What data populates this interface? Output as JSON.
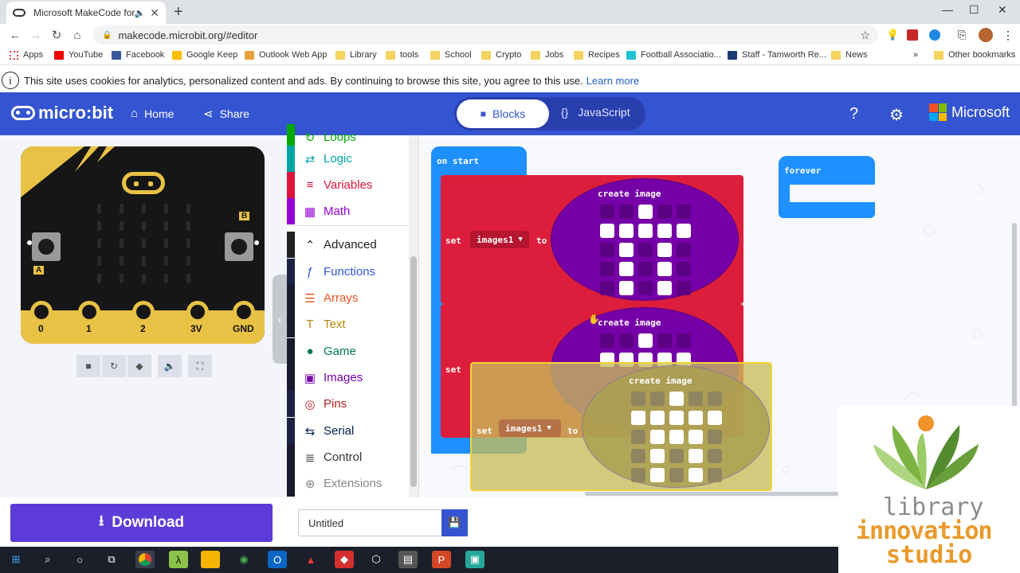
{
  "browser": {
    "tab_title": "Microsoft MakeCode for mic",
    "url": "makecode.microbit.org/#editor",
    "bookmarks": [
      "Apps",
      "YouTube",
      "Facebook",
      "Google Keep",
      "Outlook Web App",
      "Library",
      "tools",
      "School",
      "Crypto",
      "Jobs",
      "Recipes",
      "Football Associatio...",
      "Staff - Tamworth Re...",
      "News",
      "Other bookmarks"
    ]
  },
  "cookie_banner": {
    "text": "This site uses cookies for analytics, personalized content and ads. By continuing to browse this site, you agree to this use.",
    "link": "Learn more"
  },
  "header": {
    "brand": "micro:bit",
    "home": "Home",
    "share": "Share",
    "mode_blocks": "Blocks",
    "mode_js": "JavaScript",
    "microsoft": "Microsoft",
    "colors": {
      "header": "#3454d1",
      "download": "#5d3bd8"
    }
  },
  "simulator": {
    "button_a": "A",
    "button_b": "B",
    "pins": [
      "0",
      "1",
      "2",
      "3V",
      "GND"
    ]
  },
  "toolbox": {
    "items": [
      {
        "label": "Loops",
        "color": "#00aa00",
        "icon": "loop-icon"
      },
      {
        "label": "Logic",
        "color": "#00a4a6",
        "icon": "logic-icon"
      },
      {
        "label": "Variables",
        "color": "#dc143c",
        "icon": "variables-icon"
      },
      {
        "label": "Math",
        "color": "#9400d3",
        "icon": "math-icon"
      },
      {
        "label": "Advanced",
        "color": "#222222",
        "icon": "chevron-up-icon"
      },
      {
        "label": "Functions",
        "color": "#3455db",
        "icon": "function-icon"
      },
      {
        "label": "Arrays",
        "color": "#e65722",
        "icon": "arrays-icon"
      },
      {
        "label": "Text",
        "color": "#b8860b",
        "icon": "text-icon"
      },
      {
        "label": "Game",
        "color": "#007a4b",
        "icon": "game-icon"
      },
      {
        "label": "Images",
        "color": "#7600a8",
        "icon": "images-icon"
      },
      {
        "label": "Pins",
        "color": "#b22222",
        "icon": "pins-icon"
      },
      {
        "label": "Serial",
        "color": "#002050",
        "icon": "serial-icon"
      },
      {
        "label": "Control",
        "color": "#333333",
        "icon": "control-icon"
      },
      {
        "label": "Extensions",
        "color": "#888888",
        "icon": "plus-icon"
      }
    ]
  },
  "workspace": {
    "on_start": "on start",
    "forever": "forever",
    "set": "set",
    "variable": "images1",
    "to": "to",
    "create_image": "create image",
    "image1": [
      [
        0,
        0,
        1,
        0,
        0
      ],
      [
        1,
        1,
        1,
        1,
        1
      ],
      [
        0,
        1,
        0,
        1,
        0
      ],
      [
        0,
        1,
        0,
        1,
        0
      ],
      [
        0,
        1,
        0,
        1,
        0
      ]
    ],
    "image2_top": [
      [
        0,
        0,
        1,
        0,
        0
      ],
      [
        1,
        1,
        1,
        1,
        1
      ]
    ],
    "image3": [
      [
        0,
        0,
        1,
        0,
        0
      ],
      [
        1,
        1,
        1,
        1,
        1
      ],
      [
        0,
        1,
        1,
        1,
        0
      ],
      [
        0,
        1,
        0,
        1,
        0
      ],
      [
        0,
        1,
        0,
        1,
        0
      ]
    ]
  },
  "bottom": {
    "download": "Download",
    "filename": "Untitled"
  },
  "overlay_logo": {
    "line1": "library",
    "line2": "innovation",
    "line3": "studio"
  }
}
